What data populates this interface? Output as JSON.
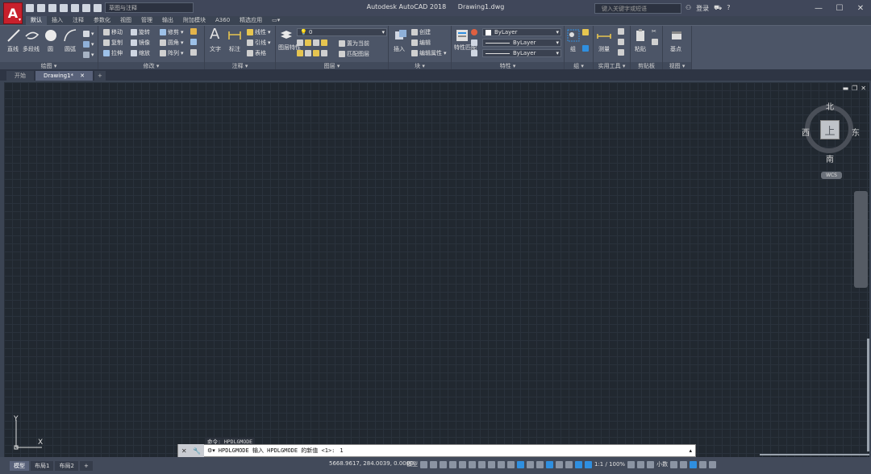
{
  "window": {
    "app_name": "Autodesk AutoCAD 2018",
    "file_name": "Drawing1.dwg"
  },
  "qat": {
    "workspace": "草图与注释"
  },
  "search": {
    "placeholder": "键入关键字或短语"
  },
  "account": {
    "login": "登录"
  },
  "ribbon_tabs": [
    "默认",
    "插入",
    "注释",
    "参数化",
    "视图",
    "管理",
    "输出",
    "附加模块",
    "A360",
    "精选应用"
  ],
  "ribbon": {
    "draw": {
      "line": "直线",
      "polyline": "多段线",
      "circle": "圆",
      "arc": "圆弧",
      "panel": "绘图 ▾"
    },
    "modify": {
      "move": "移动",
      "rotate": "旋转",
      "trim": "修剪",
      "copy": "复制",
      "mirror": "镜像",
      "fillet": "圆角",
      "stretch": "拉伸",
      "scale": "缩放",
      "array": "阵列",
      "panel": "修改 ▾"
    },
    "annotation": {
      "text": "文字",
      "dimension": "标注",
      "linear": "线性",
      "leader": "引线",
      "table": "表格",
      "panel": "注释 ▾"
    },
    "layers": {
      "layer_props": "图层特性",
      "layer_value": "0",
      "make_current": "置为当前",
      "match_layer": "匹配图层",
      "panel": "图层 ▾"
    },
    "block": {
      "insert": "插入",
      "create": "创建",
      "edit": "编辑",
      "edit_attr": "编辑属性",
      "panel": "块 ▾"
    },
    "properties": {
      "match": "特性匹配",
      "color": "ByLayer",
      "linetype": "ByLayer",
      "lineweight": "ByLayer",
      "panel": "特性 ▾"
    },
    "groups": {
      "group": "组",
      "panel": "组 ▾"
    },
    "utilities": {
      "measure": "测量",
      "panel": "实用工具 ▾"
    },
    "clipboard": {
      "paste": "粘贴",
      "panel": "剪贴板"
    },
    "view": {
      "base": "基点",
      "panel": "视图 ▾"
    }
  },
  "file_tabs": {
    "start": "开始",
    "drawing": "Drawing1*"
  },
  "viewcube": {
    "north": "北",
    "south": "南",
    "east": "东",
    "west": "西",
    "top": "上",
    "wcs": "WCS"
  },
  "command": {
    "history": "命令: HPDLGMODE",
    "prompt": "HPDLGMODE 输入 HPDLGMODE 的新值 <1>:",
    "value": "1"
  },
  "ucs": {
    "x": "X",
    "y": "Y"
  },
  "status": {
    "layout_tabs": [
      "模型",
      "布局1",
      "布局2"
    ],
    "coords": "5668.9617, 284.0039, 0.0000",
    "model": "模型",
    "scale": "1:1 / 100%",
    "units": "小数"
  }
}
